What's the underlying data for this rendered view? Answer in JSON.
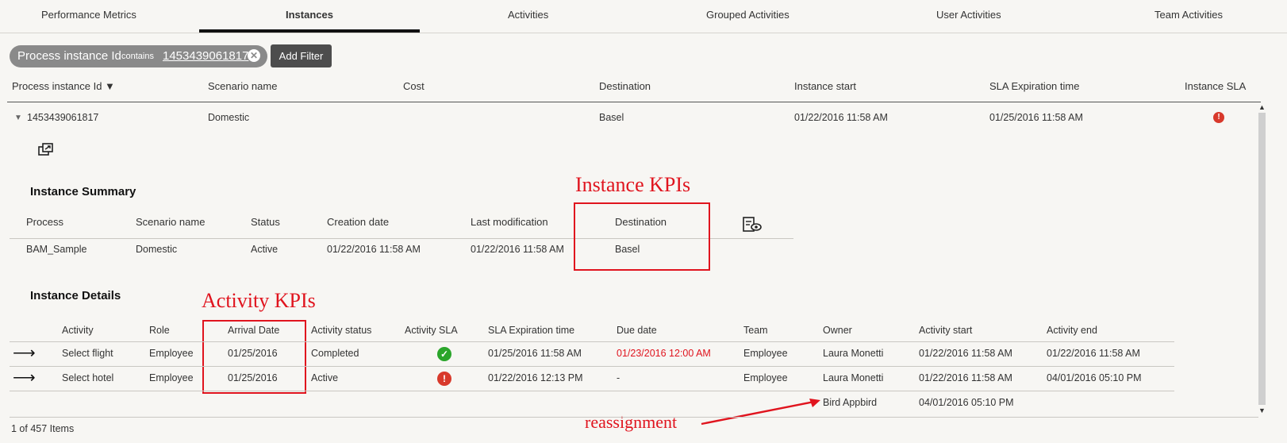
{
  "tabs": [
    {
      "label": "Performance Metrics"
    },
    {
      "label": "Instances"
    },
    {
      "label": "Activities"
    },
    {
      "label": "Grouped Activities"
    },
    {
      "label": "User Activities"
    },
    {
      "label": "Team Activities"
    }
  ],
  "filter": {
    "field": "Process instance Id",
    "op": "contains",
    "value": "1453439061817",
    "add_label": "Add Filter"
  },
  "table": {
    "headers": [
      "Process instance Id ▼",
      "Scenario name",
      "Cost",
      "Destination",
      "Instance start",
      "SLA Expiration time",
      "Instance SLA"
    ],
    "row": {
      "id": "1453439061817",
      "scenario": "Domestic",
      "cost": "",
      "destination": "Basel",
      "start": "01/22/2016 11:58 AM",
      "sla_exp": "01/25/2016 11:58 AM"
    }
  },
  "summary": {
    "title": "Instance Summary",
    "headers": [
      "Process",
      "Scenario name",
      "Status",
      "Creation date",
      "Last modification",
      "Destination"
    ],
    "row": [
      "BAM_Sample",
      "Domestic",
      "Active",
      "01/22/2016 11:58 AM",
      "01/22/2016 11:58 AM",
      "Basel"
    ]
  },
  "details": {
    "title": "Instance Details",
    "headers": [
      "Activity",
      "Role",
      "Arrival Date",
      "Activity status",
      "Activity SLA",
      "SLA Expiration time",
      "Due date",
      "Team",
      "Owner",
      "Activity start",
      "Activity end"
    ],
    "rows": [
      {
        "activity": "Select flight",
        "role": "Employee",
        "arrival": "01/25/2016",
        "status": "Completed",
        "sla_exp": "01/25/2016 11:58 AM",
        "due": "01/23/2016 12:00 AM",
        "team": "Employee",
        "owner": "Laura Monetti",
        "start": "01/22/2016 11:58 AM",
        "end": "01/22/2016 11:58 AM"
      },
      {
        "activity": "Select hotel",
        "role": "Employee",
        "arrival": "01/25/2016",
        "status": "Active",
        "sla_exp": "01/22/2016 12:13 PM",
        "due": "-",
        "team": "Employee",
        "owner": "Laura Monetti",
        "start": "01/22/2016 11:58 AM",
        "end": "04/01/2016 05:10 PM"
      }
    ],
    "reassign": {
      "owner": "Bird Appbird",
      "start": "04/01/2016 05:10 PM"
    }
  },
  "annotations": {
    "instance_kpis": "Instance KPIs",
    "activity_kpis": "Activity KPIs",
    "reassignment": "reassignment"
  },
  "footer": {
    "count": "1 of 457 Items"
  },
  "colors": {
    "annotation": "#e0141e",
    "due_overdue": "#e0141e",
    "ok": "#2aa52a",
    "error": "#d8392b"
  }
}
